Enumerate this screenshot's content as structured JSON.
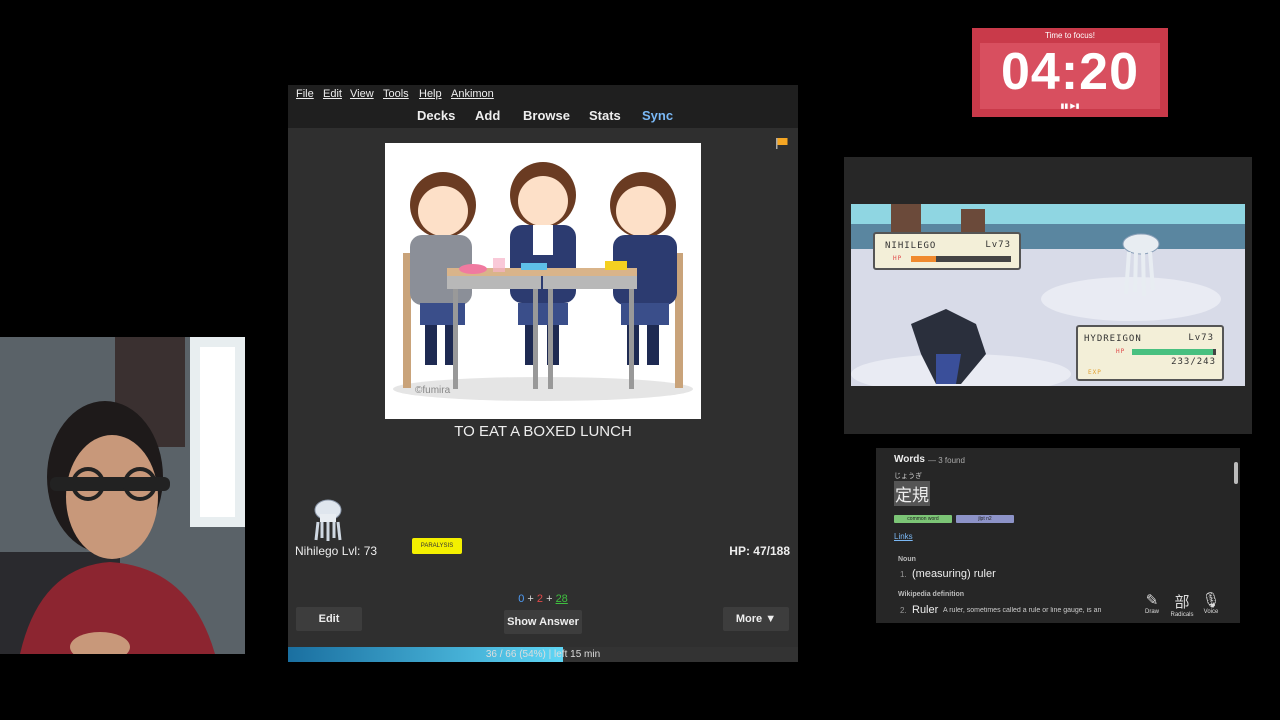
{
  "anki": {
    "menu": [
      "File",
      "Edit",
      "View",
      "Tools",
      "Help",
      "Ankimon"
    ],
    "toolbar": [
      "Decks",
      "Add",
      "Browse",
      "Stats",
      "Sync"
    ],
    "card_text": "TO EAT A BOXED LUNCH",
    "image_credit": "©fumira",
    "pokemon_name": "Nihilego Lvl: 73",
    "status_badge": "PARALYSIS",
    "hp": "HP: 47/188",
    "counts": {
      "new": "0",
      "learn": "2",
      "review": "28",
      "plus": "+"
    },
    "buttons": {
      "edit": "Edit",
      "show_answer": "Show Answer",
      "more": "More ▼"
    },
    "progress": {
      "text": "36 / 66 (54%) | left 15 min",
      "fraction": 0.54
    },
    "colors": {
      "new": "#4f9cf5",
      "learn": "#e04848",
      "review": "#3fbf3f",
      "sync": "#7ab8f5",
      "flag": "#f5a623"
    }
  },
  "timer": {
    "title": "Time to focus!",
    "time": "04:20",
    "controls": "▮▮ ▶▮"
  },
  "game": {
    "enemy": {
      "name": "NIHILEGO",
      "level": "Lv73",
      "hp_label": "HP",
      "hp_fraction": 0.25
    },
    "player": {
      "name": "HYDREIGON",
      "level": "Lv73",
      "hp_label": "HP",
      "hp_text": "233/243",
      "hp_fraction": 0.96,
      "exp_label": "EXP"
    }
  },
  "dict": {
    "title": "Words",
    "found": "— 3 found",
    "furigana": "じょうぎ",
    "word": "定規",
    "tags": [
      "common word",
      "jlpt n2"
    ],
    "links": "Links",
    "pos": "Noun",
    "def1_num": "1.",
    "def1": "(measuring) ruler",
    "wiki_label": "Wikipedia definition",
    "def2_num": "2.",
    "def2": "Ruler",
    "def2_desc": "A ruler, sometimes called a rule or line gauge, is an",
    "tools": [
      {
        "icon": "✎",
        "label": "Draw"
      },
      {
        "icon": "部",
        "label": "Radicals"
      },
      {
        "icon": "🎙",
        "label": "Voice"
      }
    ]
  }
}
